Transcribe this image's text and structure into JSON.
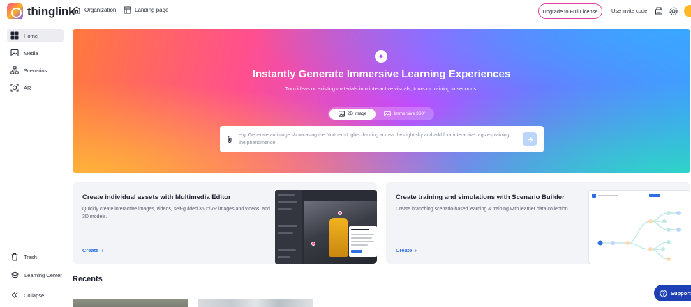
{
  "brand": {
    "name": "thinglink"
  },
  "topnav": {
    "organization": "Organization",
    "landing_page": "Landing page",
    "upgrade": "Upgrade to Full License",
    "invite": "Use invite code"
  },
  "sidebar": {
    "items": [
      {
        "label": "Home",
        "icon": "grid-icon"
      },
      {
        "label": "Media",
        "icon": "image-icon"
      },
      {
        "label": "Scenarios",
        "icon": "flow-icon"
      },
      {
        "label": "AR",
        "icon": "ar-icon"
      }
    ],
    "bottom": [
      {
        "label": "Trash",
        "icon": "trash-icon"
      },
      {
        "label": "Learning Center",
        "icon": "graduation-cap-icon"
      },
      {
        "label": "Collapse",
        "icon": "collapse-icon"
      }
    ]
  },
  "hero": {
    "title": "Instantly Generate Immersive Learning Experiences",
    "subtitle": "Turn ideas or existing materials into interactive visuals, tours or training in seconds.",
    "toggle": {
      "option_1": "2D image",
      "option_2": "Immersive 360°",
      "selected": "2D image"
    },
    "prompt_placeholder": "e.g. Generate an image showcasing the Northern Lights dancing across the night sky and add four interactive tags explaining the phenomenon"
  },
  "cards": [
    {
      "title": "Create individual assets with Multimedia Editor",
      "description": "Quickly create interactive images, videos, self-guided 360°/VR images and videos, and 3D models.",
      "cta": "Create"
    },
    {
      "title": "Create training and simulations with Scenario Builder",
      "description": "Create branching scenario-based learning & training with learner data collection.",
      "cta": "Create"
    }
  ],
  "recents": {
    "title": "Recents"
  },
  "support": {
    "label": "Support"
  },
  "colors": {
    "accent": "#2f6ee0",
    "upgrade_border": "#e0459b",
    "support_bg": "#1f3fb5",
    "avatar": "#ffb627"
  }
}
